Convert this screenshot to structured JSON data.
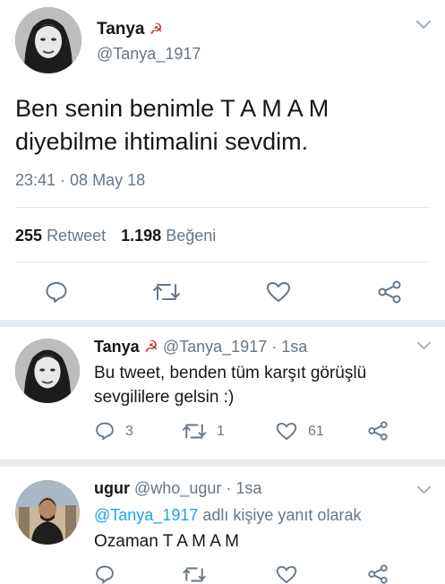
{
  "main_tweet": {
    "name": "Tanya",
    "name_symbol": "☭",
    "handle": "@Tanya_1917",
    "text_line1": "Ben senin benimle T A M A M",
    "text_line2": "diyebilme ihtimalini sevdim.",
    "timestamp": "23:41 · 08 May 18",
    "retweet_count": "255",
    "retweet_label": "Retweet",
    "like_count": "1.198",
    "like_label": "Beğeni"
  },
  "reply1": {
    "name": "Tanya",
    "name_symbol": "☭",
    "handle": "@Tanya_1917",
    "time": "· 1sa",
    "text_line1": "Bu tweet, benden tüm karşıt görüşlü",
    "text_line2": "sevgililere gelsin :)",
    "reply_count": "3",
    "retweet_count": "1",
    "like_count": "61"
  },
  "reply2": {
    "name": "ugur",
    "handle": "@who_ugur",
    "time": "· 1sa",
    "reply_to_handle": "@Tanya_1917",
    "reply_to_suffix": "adlı kişiye yanıt olarak",
    "text": "Ozaman T A M A M"
  },
  "icons": {
    "reply": "reply-icon",
    "retweet": "retweet-icon",
    "like": "heart-icon",
    "share": "share-icon",
    "caret": "chevron-down-icon"
  },
  "colors": {
    "text": "#14171a",
    "muted": "#657786",
    "link": "#1da1f2",
    "divider": "#e1e8ed"
  }
}
